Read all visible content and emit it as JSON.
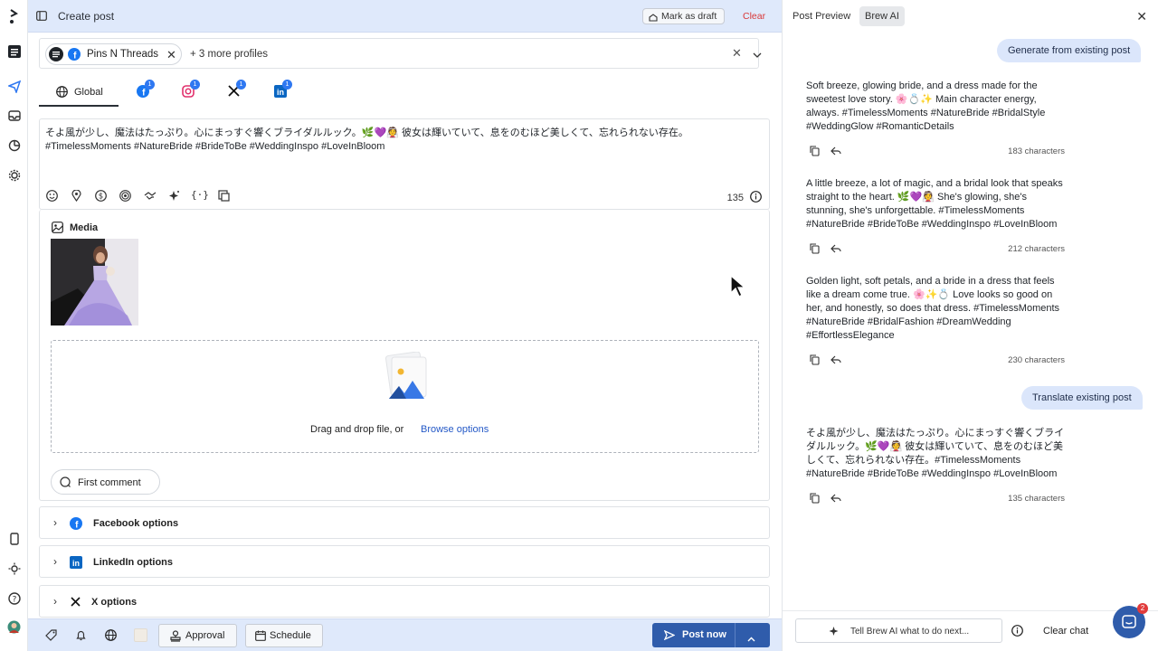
{
  "editor": {
    "title": "Create post",
    "mark_draft": "Mark as draft",
    "clear": "Clear",
    "profile_chip": "Pins N Threads",
    "more_profiles": "+ 3 more profiles",
    "tabs": [
      {
        "label": "Global"
      },
      {
        "badge": "1"
      },
      {
        "badge": "1"
      },
      {
        "badge": "1"
      },
      {
        "badge": "1"
      }
    ],
    "post_text": "そよ風が少し、魔法はたっぷり。心にまっすぐ響くブライダルルック。🌿💜👰 彼女は輝いていて、息をのむほど美しくて、忘れられない存在。#TimelessMoments #NatureBride #BrideToBe #WeddingInspo #LoveInBloom",
    "char_count": "135",
    "media_title": "Media",
    "dropzone_text": "Drag and drop file, or",
    "dropzone_link": "Browse options",
    "first_comment": "First comment",
    "options": [
      {
        "label": "Facebook options"
      },
      {
        "label": "LinkedIn options"
      },
      {
        "label": "X options"
      }
    ],
    "bottom": {
      "approval": "Approval",
      "schedule": "Schedule",
      "post_now": "Post now"
    }
  },
  "panel": {
    "tab_preview": "Post Preview",
    "tab_brew": "Brew AI",
    "prompt1": "Generate from existing post",
    "prompt2": "Translate existing post",
    "responses": [
      {
        "text": "Soft breeze, glowing bride, and a dress made for the sweetest love story. 🌸💍✨ Main character energy, always. #TimelessMoments #NatureBride #BridalStyle #WeddingGlow #RomanticDetails",
        "chars": "183 characters"
      },
      {
        "text": "A little breeze, a lot of magic, and a bridal look that speaks straight to the heart. 🌿💜👰 She's glowing, she's stunning, she's unforgettable. #TimelessMoments #NatureBride #BrideToBe #WeddingInspo #LoveInBloom",
        "chars": "212 characters"
      },
      {
        "text": "Golden light, soft petals, and a bride in a dress that feels like a dream come true. 🌸✨💍 Love looks so good on her, and honestly, so does that dress. #TimelessMoments #NatureBride #BridalFashion #DreamWedding #EffortlessElegance",
        "chars": "230 characters"
      },
      {
        "text": "そよ風が少し、魔法はたっぷり。心にまっすぐ響くブライダルルック。🌿💜👰 彼女は輝いていて、息をのむほど美しくて、忘れられない存在。#TimelessMoments #NatureBride #BrideToBe #WeddingInspo #LoveInBloom",
        "chars": "135 characters"
      }
    ],
    "composer_placeholder": "Tell Brew AI what to do next...",
    "clear_chat": "Clear chat",
    "intercom_badge": "2"
  },
  "colors": {
    "accent": "#2f5cab",
    "topbar": "#dfe9fb",
    "clear": "#d93838",
    "link": "#2459c7"
  }
}
